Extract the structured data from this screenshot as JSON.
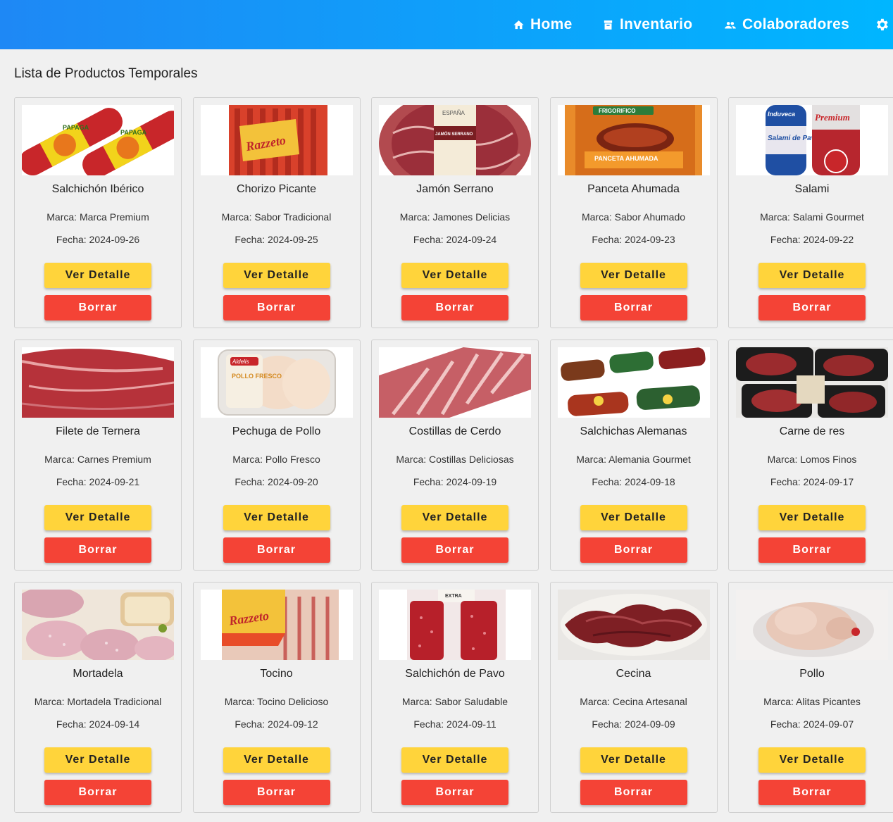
{
  "nav": {
    "home_label": "Home",
    "inventory_label": "Inventario",
    "collaborators_label": "Colaboradores",
    "home_icon": "home-icon",
    "inventory_icon": "inventory-icon",
    "collaborators_icon": "people-icon",
    "settings_icon": "gear-icon"
  },
  "page": {
    "title": "Lista de Productos Temporales"
  },
  "buttons": {
    "detail_label": "Ver Detalle",
    "delete_label": "Borrar"
  },
  "products": [
    {
      "name": "Salchichón Ibérico",
      "brand": "Marca: Marca Premium",
      "date": "Fecha: 2024-09-26",
      "img": "salchichon"
    },
    {
      "name": "Chorizo Picante",
      "brand": "Marca: Sabor Tradicional",
      "date": "Fecha: 2024-09-25",
      "img": "razzeto"
    },
    {
      "name": "Jamón Serrano",
      "brand": "Marca: Jamones Delicias",
      "date": "Fecha: 2024-09-24",
      "img": "jamon"
    },
    {
      "name": "Panceta Ahumada",
      "brand": "Marca: Sabor Ahumado",
      "date": "Fecha: 2024-09-23",
      "img": "panceta"
    },
    {
      "name": "Salami",
      "brand": "Marca: Salami Gourmet",
      "date": "Fecha: 2024-09-22",
      "img": "salami"
    },
    {
      "name": "Filete de Ternera",
      "brand": "Marca: Carnes Premium",
      "date": "Fecha: 2024-09-21",
      "img": "ternera"
    },
    {
      "name": "Pechuga de Pollo",
      "brand": "Marca: Pollo Fresco",
      "date": "Fecha: 2024-09-20",
      "img": "pechuga"
    },
    {
      "name": "Costillas de Cerdo",
      "brand": "Marca: Costillas Deliciosas",
      "date": "Fecha: 2024-09-19",
      "img": "costillas"
    },
    {
      "name": "Salchichas Alemanas",
      "brand": "Marca: Alemania Gourmet",
      "date": "Fecha: 2024-09-18",
      "img": "salchichas"
    },
    {
      "name": "Carne de res",
      "brand": "Marca: Lomos Finos",
      "date": "Fecha: 2024-09-17",
      "img": "res"
    },
    {
      "name": "Mortadela",
      "brand": "Marca: Mortadela Tradicional",
      "date": "Fecha: 2024-09-14",
      "img": "mortadela"
    },
    {
      "name": "Tocino",
      "brand": "Marca: Tocino Delicioso",
      "date": "Fecha: 2024-09-12",
      "img": "tocino"
    },
    {
      "name": "Salchichón de Pavo",
      "brand": "Marca: Sabor Saludable",
      "date": "Fecha: 2024-09-11",
      "img": "pavo"
    },
    {
      "name": "Cecina",
      "brand": "Marca: Cecina Artesanal",
      "date": "Fecha: 2024-09-09",
      "img": "cecina"
    },
    {
      "name": "Pollo",
      "brand": "Marca: Alitas Picantes",
      "date": "Fecha: 2024-09-07",
      "img": "pollo"
    }
  ],
  "image_text": {
    "papaga": "PAPAGA",
    "razzeto": "Razzeto",
    "espana": "ESPAÑA",
    "jamon_serrano": "JAMÓN SERRANO",
    "frigorifico": "FRIGORIFICO",
    "panceta_label": "PANCETA AHUMADA",
    "induveca": "Induveca",
    "salami_pavo": "Salami de Pavo",
    "premium": "Premium",
    "aldelis": "Aldelis",
    "pollo_fresco": "POLLO FRESCO",
    "extra": "EXTRA"
  }
}
